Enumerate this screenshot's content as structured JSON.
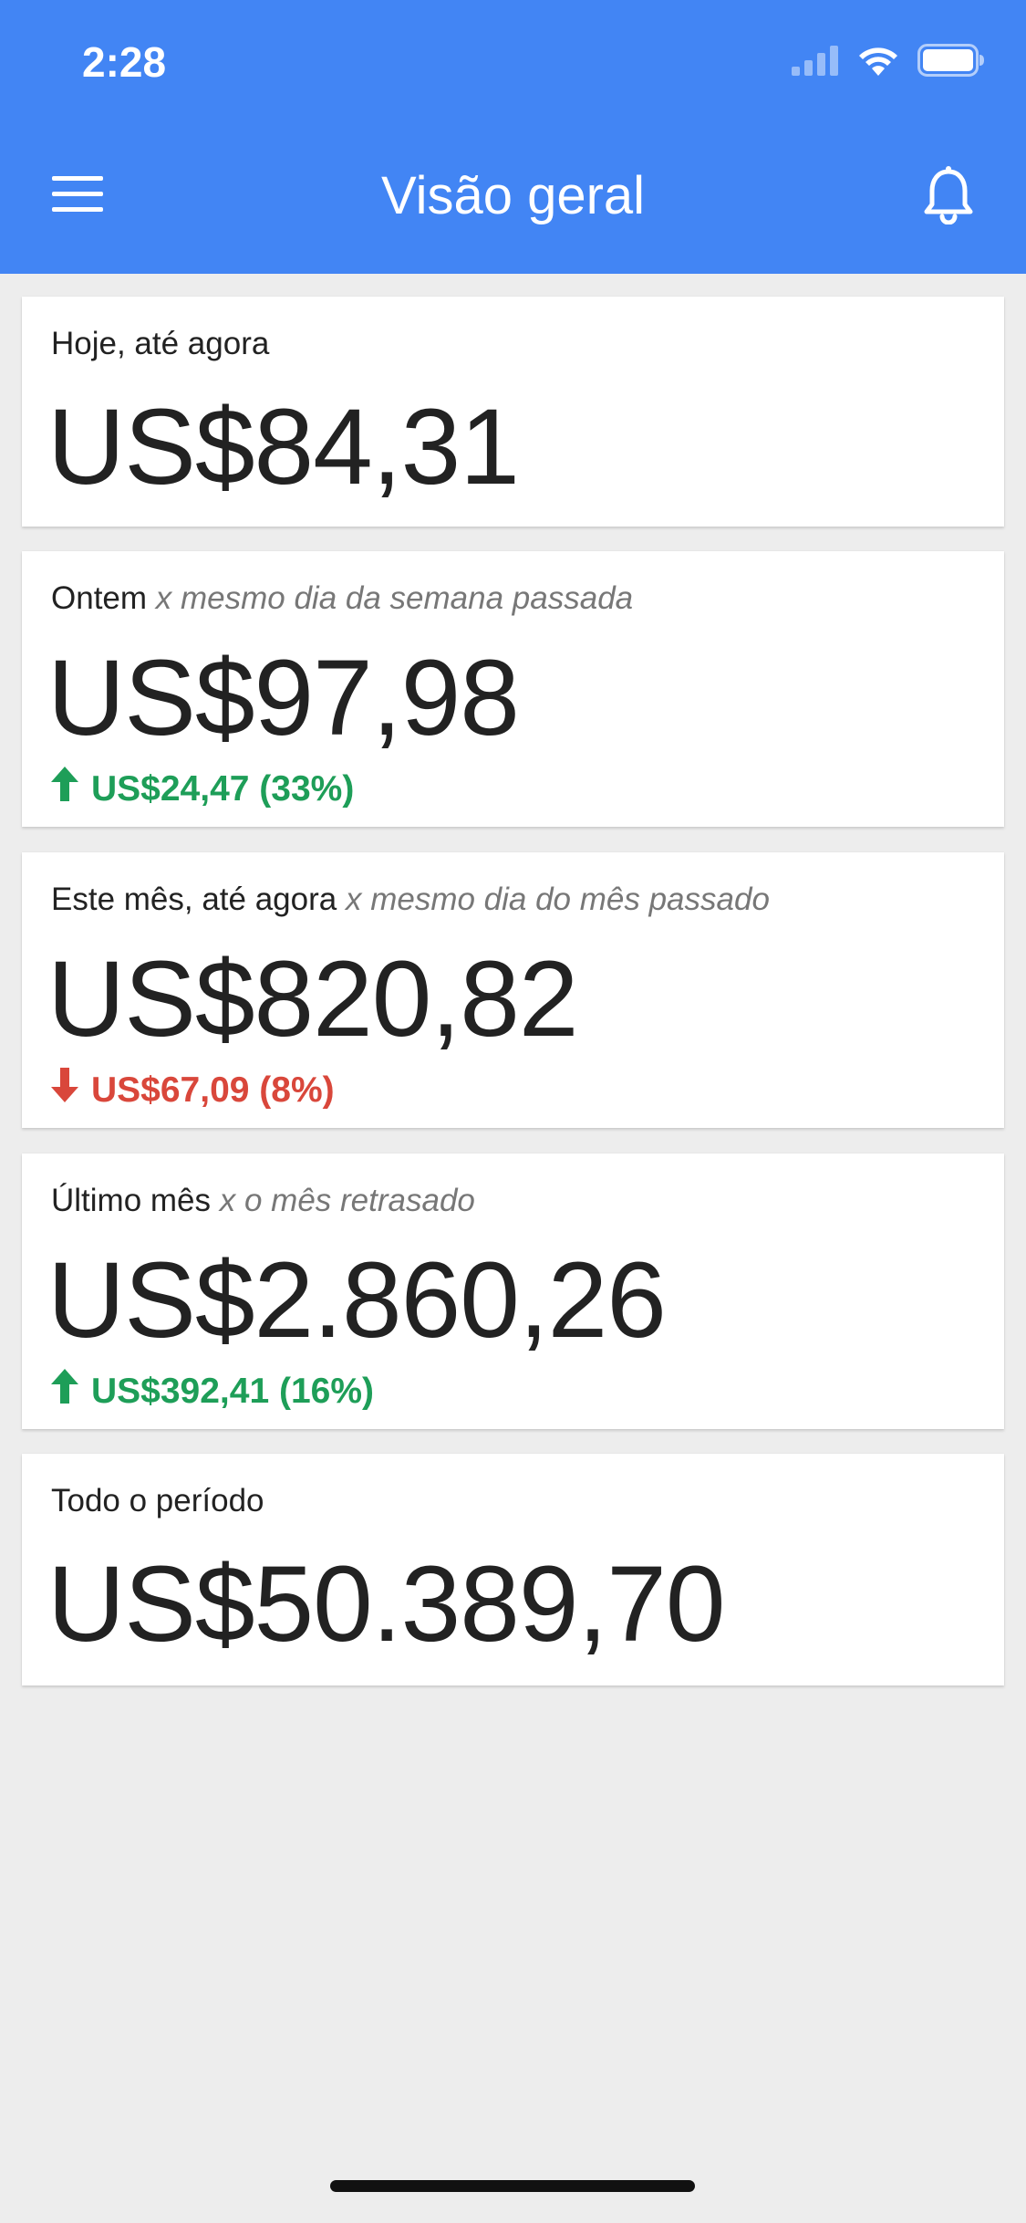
{
  "status_bar": {
    "time": "2:28"
  },
  "header": {
    "title": "Visão geral",
    "menu_icon": "hamburger-menu-icon",
    "notification_icon": "bell-icon"
  },
  "colors": {
    "appbar": "#4285f4",
    "background": "#ededed",
    "positive": "#1e9e58",
    "negative": "#d9473b"
  },
  "cards": [
    {
      "label": "Hoje, até agora",
      "comparison": "",
      "value": "US$84,31",
      "change": null
    },
    {
      "label": "Ontem",
      "comparison": "x mesmo dia da semana passada",
      "value": "US$97,98",
      "change": {
        "direction": "up",
        "icon": "arrow-up-icon",
        "text": "US$24,47 (33%)"
      }
    },
    {
      "label": "Este mês, até agora",
      "comparison": "x mesmo dia do mês passado",
      "value": "US$820,82",
      "change": {
        "direction": "down",
        "icon": "arrow-down-icon",
        "text": "US$67,09 (8%)"
      }
    },
    {
      "label": "Último mês",
      "comparison": "x o mês retrasado",
      "value": "US$2.860,26",
      "change": {
        "direction": "up",
        "icon": "arrow-up-icon",
        "text": "US$392,41 (16%)"
      }
    },
    {
      "label": "Todo o período",
      "comparison": "",
      "value": "US$50.389,70",
      "change": null
    }
  ]
}
